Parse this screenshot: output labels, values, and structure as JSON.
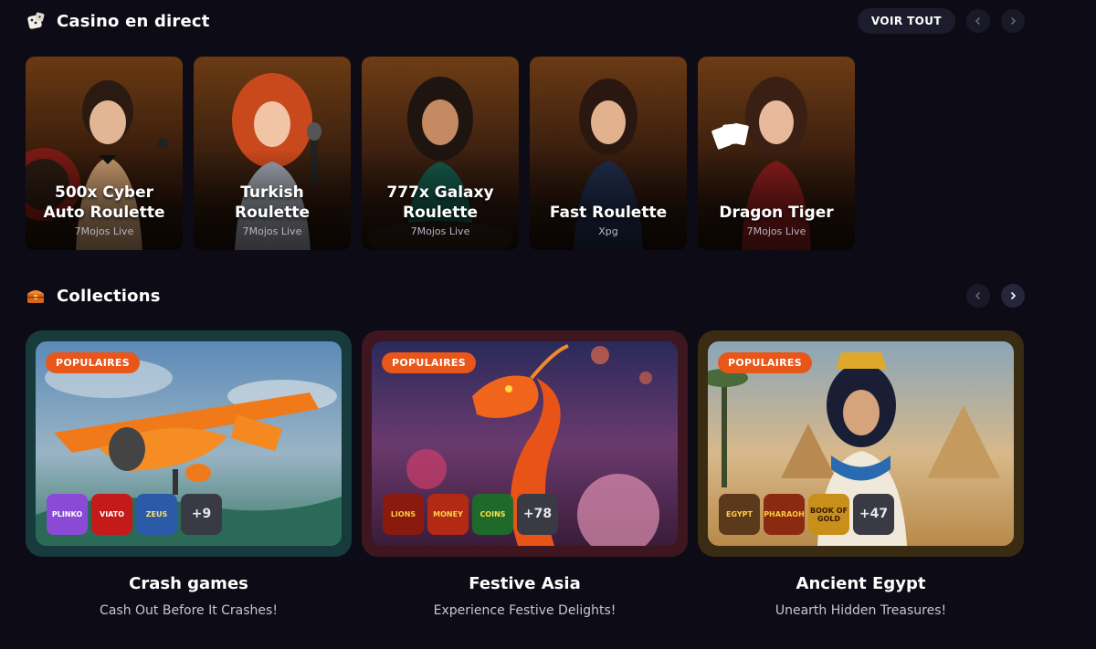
{
  "live_section": {
    "title": "Casino en direct",
    "icon": "dice-icon",
    "voir_tout": "VOIR TOUT",
    "games": [
      {
        "name_line1": "500x Cyber",
        "name_line2": "Auto Roulette",
        "provider": "7Mojos Live"
      },
      {
        "name_line1": "Turkish",
        "name_line2": "Roulette",
        "provider": "7Mojos Live"
      },
      {
        "name_line1": "777x Galaxy",
        "name_line2": "Roulette",
        "provider": "7Mojos Live"
      },
      {
        "name_line1": "",
        "name_line2": "Fast Roulette",
        "provider": "Xpg"
      },
      {
        "name_line1": "",
        "name_line2": "Dragon Tiger",
        "provider": "7Mojos Live"
      }
    ]
  },
  "collections_section": {
    "title": "Collections",
    "icon": "treasure-chest-icon",
    "items": [
      {
        "badge": "POPULAIRES",
        "title": "Crash games",
        "subtitle": "Cash Out Before It Crashes!",
        "thumbs": [
          "PLINKO",
          "VIATO",
          "ZEUS"
        ],
        "more": "+9",
        "frame_color": "#173a3c"
      },
      {
        "badge": "POPULAIRES",
        "title": "Festive Asia",
        "subtitle": "Experience Festive Delights!",
        "thumbs": [
          "LIONS",
          "MONEY",
          "COINS"
        ],
        "more": "+78",
        "frame_color": "#3e1620"
      },
      {
        "badge": "POPULAIRES",
        "title": "Ancient Egypt",
        "subtitle": "Unearth Hidden Treasures!",
        "thumbs": [
          "EGYPT",
          "PHARAOH",
          "BOOK OF GOLD"
        ],
        "more": "+47",
        "frame_color": "#3a2c12"
      }
    ]
  },
  "colors": {
    "background": "#0c0b16",
    "badge": "#e9561a",
    "button": "#1d1c2c"
  }
}
